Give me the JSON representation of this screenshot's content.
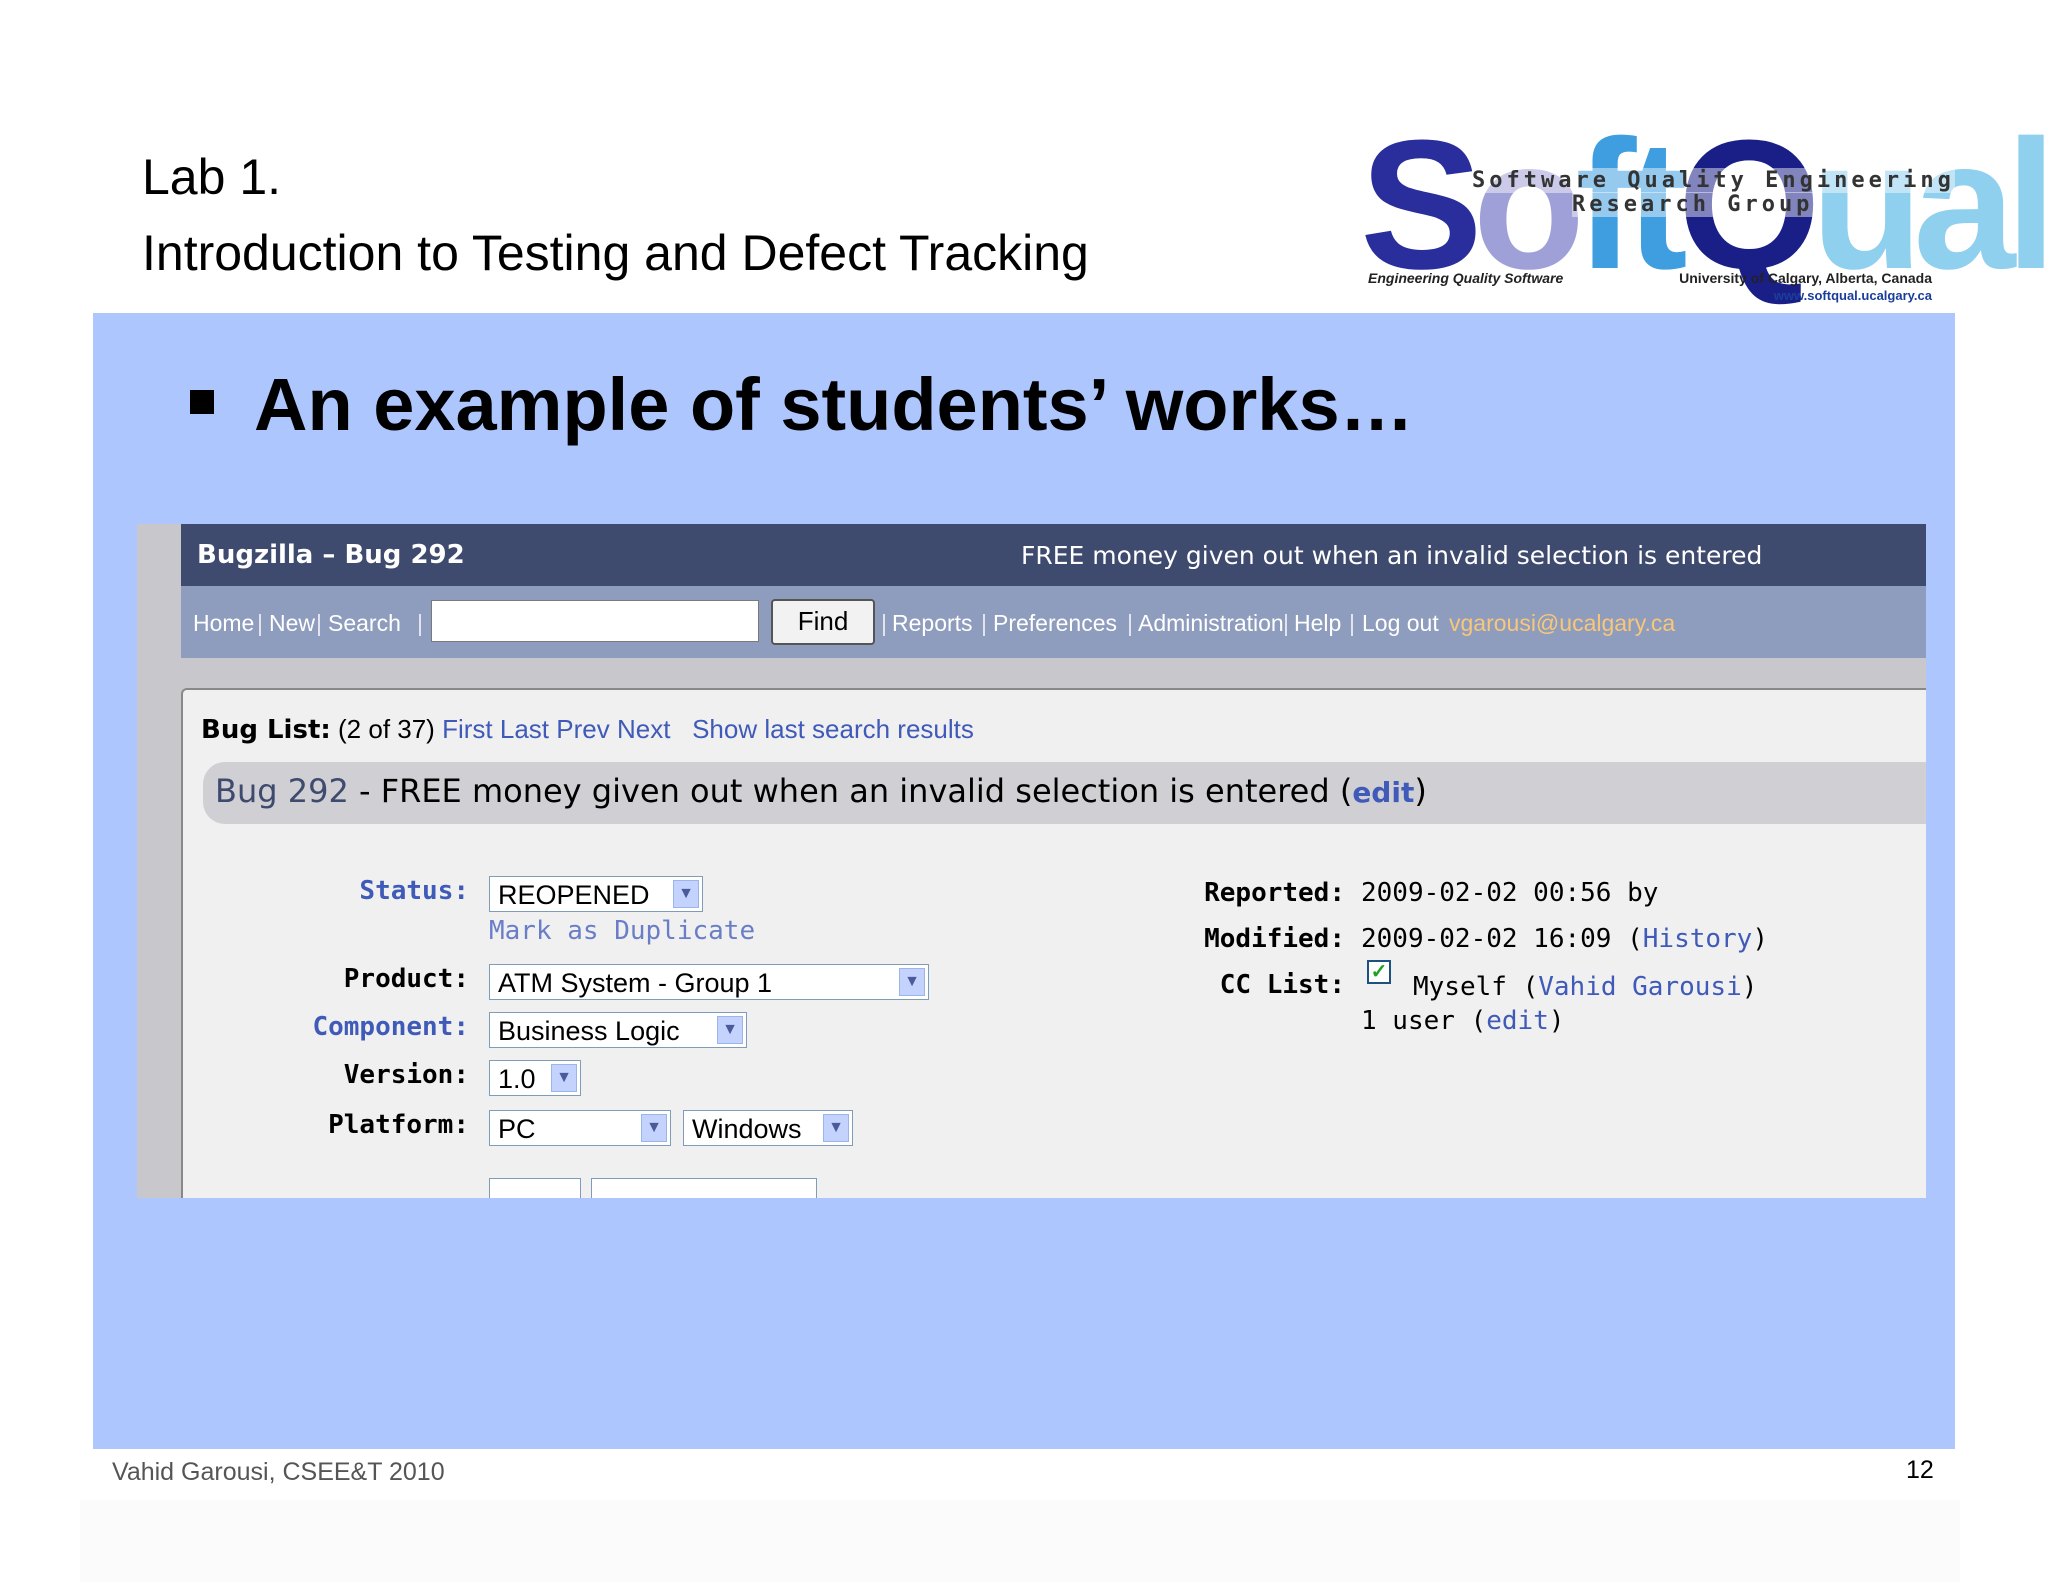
{
  "slide": {
    "lab_title": "Lab 1.",
    "lab_subtitle": "Introduction to Testing and Defect Tracking",
    "bullet_text": "An example of students’ works…",
    "footer_author": "Vahid Garousi, CSEE&T 2010",
    "page_number": "12"
  },
  "logo": {
    "parts": [
      "S",
      "o",
      "ft",
      "Q",
      "ual"
    ],
    "tagline_line1": "Software Quality Engineering",
    "tagline_line2": "Research Group",
    "left_caption": "Engineering Quality Software",
    "right_caption": "University of Calgary, Alberta, Canada",
    "url": "www.softqual.ucalgary.ca"
  },
  "bugzilla": {
    "title_left": "Bugzilla – Bug 292",
    "title_right": "FREE money given out when an invalid selection is entered",
    "nav": {
      "home": "Home",
      "new": "New",
      "search": "Search",
      "search_value": "",
      "find": "Find",
      "reports": "Reports",
      "preferences": "Preferences",
      "administration": "Administration",
      "help": "Help",
      "logout": "Log out",
      "user_email": "vgarousi@ucalgary.ca",
      "separator": "|"
    },
    "buglist": {
      "label": "Bug List:",
      "count": "(2 of 37)",
      "first": "First",
      "last": "Last",
      "prev": "Prev",
      "next": "Next",
      "show_last": "Show last search results"
    },
    "bug_heading": {
      "number": "Bug 292",
      "summary": " - FREE money given out when an invalid selection is entered ",
      "edit": "edit"
    },
    "fields": {
      "status_label": "Status:",
      "status_value": "REOPENED",
      "mark_duplicate": "Mark as Duplicate",
      "product_label": "Product:",
      "product_value": "ATM System - Group 1",
      "component_label": "Component:",
      "component_value": "Business Logic",
      "version_label": "Version:",
      "version_value": "1.0",
      "platform_label": "Platform:",
      "platform_value": "PC",
      "os_value": "Windows"
    },
    "meta": {
      "reported_label": "Reported:",
      "reported_value": "2009-02-02 00:56 by",
      "modified_label": "Modified:",
      "modified_value": "2009-02-02 16:09",
      "history_link": "History",
      "cc_label": "CC List:",
      "cc_myself": "Myself",
      "cc_name": "Vahid Garousi",
      "cc_count": "1 user",
      "cc_edit": "edit"
    }
  },
  "colors": {
    "body_panel": "#aec6fe",
    "title_bar": "#3e4a6e",
    "nav_bar": "#8e9cbd",
    "link": "#3f5ab8",
    "email": "#f8c779"
  }
}
